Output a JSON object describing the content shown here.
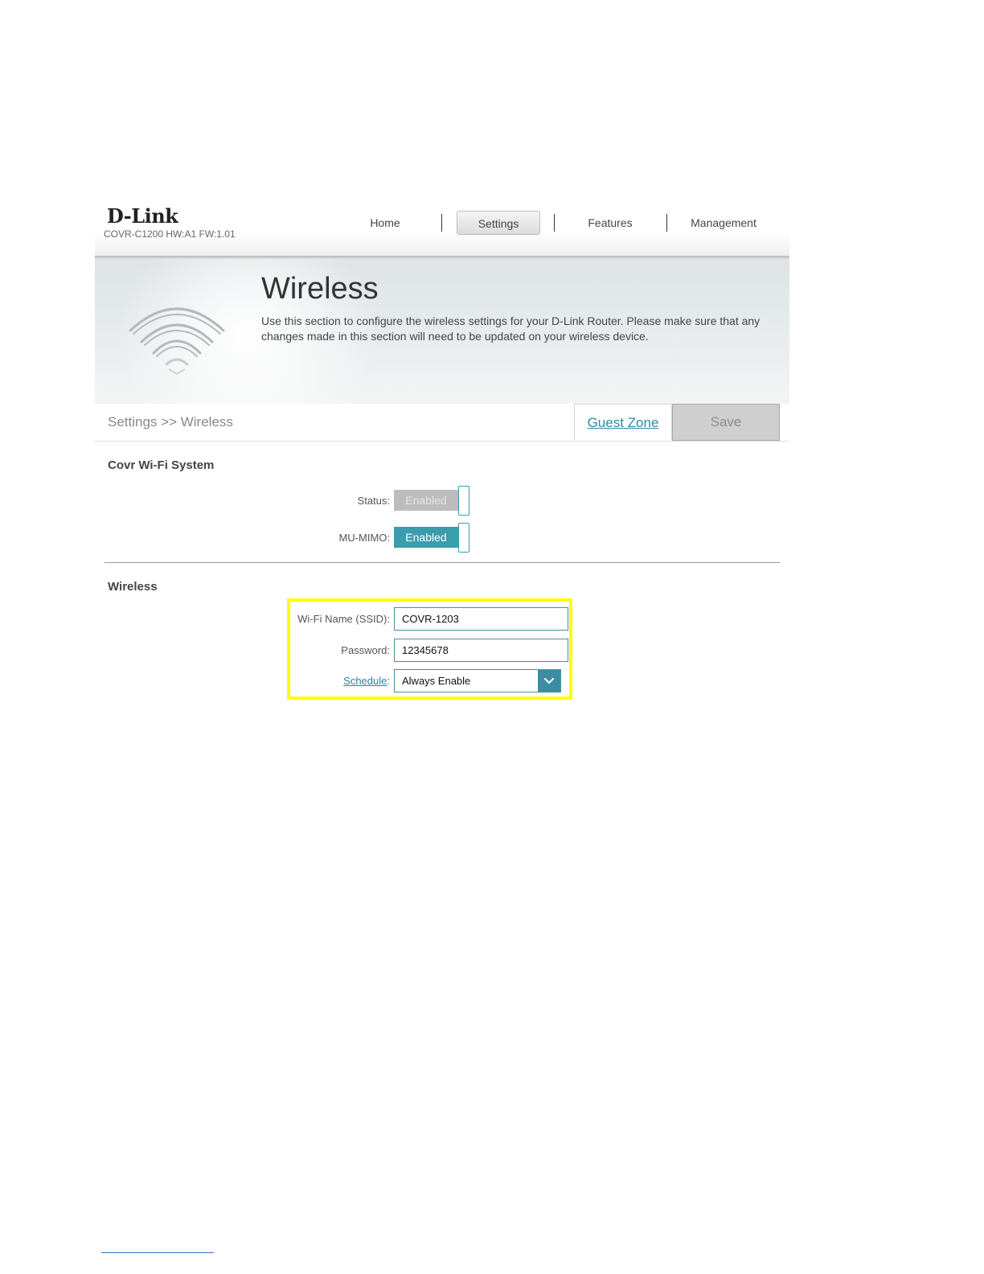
{
  "header": {
    "logo": "D-Link",
    "model_info": "COVR-C1200 HW:A1 FW:1.01",
    "nav": [
      {
        "label": "Home",
        "active": false
      },
      {
        "label": "Settings",
        "active": true
      },
      {
        "label": "Features",
        "active": false
      },
      {
        "label": "Management",
        "active": false
      }
    ]
  },
  "banner": {
    "title": "Wireless",
    "description": "Use this section to configure the wireless settings for your D-Link Router. Please make sure that any changes made in this section will need to be updated on your wireless device.",
    "icon": "wifi-icon"
  },
  "breadcrumb": {
    "text": "Settings >> Wireless",
    "guest_zone_label": "Guest Zone",
    "save_label": "Save"
  },
  "covr_section": {
    "title": "Covr Wi-Fi System",
    "status": {
      "label": "Status:",
      "value": "Enabled",
      "active": false
    },
    "mu_mimo": {
      "label": "MU-MIMO:",
      "value": "Enabled",
      "active": true
    }
  },
  "wireless_section": {
    "title": "Wireless",
    "ssid": {
      "label": "Wi-Fi Name (SSID):",
      "value": "COVR-1203"
    },
    "password": {
      "label": "Password:",
      "value": "12345678"
    },
    "schedule": {
      "link_label": "Schedule",
      "suffix": ":",
      "value": "Always Enable",
      "icon": "chevron-down-icon"
    }
  },
  "colors": {
    "accent": "#3b9cae",
    "highlight": "#ffff00",
    "link": "#2a8fa0",
    "disabled_toggle": "#bcbcbc"
  }
}
